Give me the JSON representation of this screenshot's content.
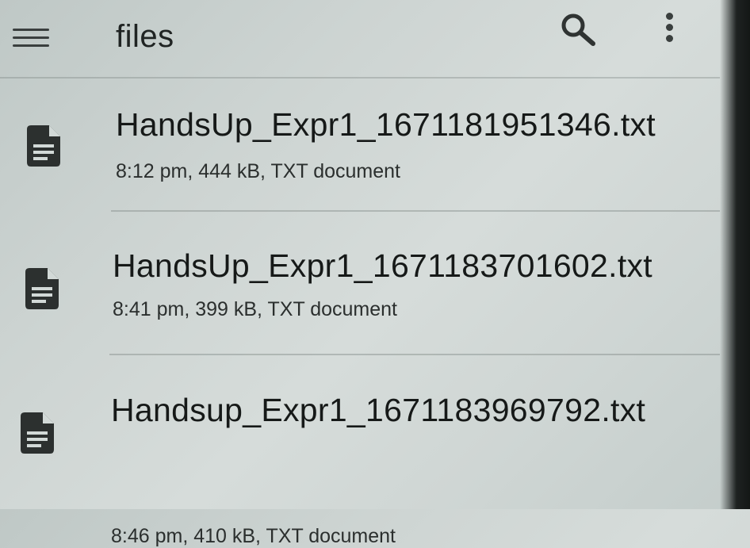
{
  "header": {
    "title": "files",
    "menu_icon": "hamburger-menu-icon",
    "search_icon": "search-icon",
    "more_icon": "more-vert-icon"
  },
  "files": [
    {
      "name": "HandsUp_Expr1_1671181951346.txt",
      "meta": "8:12 pm, 444 kB, TXT document",
      "icon": "document-icon"
    },
    {
      "name": "HandsUp_Expr1_1671183701602.txt",
      "meta": "8:41 pm, 399 kB, TXT document",
      "icon": "document-icon"
    },
    {
      "name": "Handsup_Expr1_1671183969792.txt",
      "meta": "8:46 pm, 410 kB, TXT document",
      "icon": "document-icon"
    }
  ],
  "colors": {
    "background": "#d6dcda",
    "text": "#161918",
    "icon": "#2c302f"
  }
}
